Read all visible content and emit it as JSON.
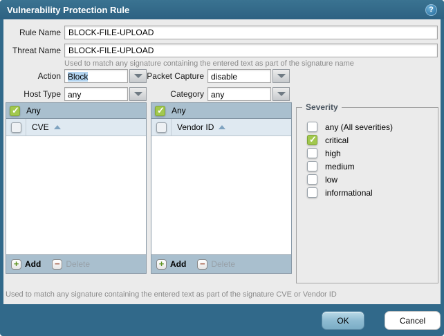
{
  "dialog": {
    "title": "Vulnerability Protection Rule"
  },
  "icons": {
    "help": "question-mark-circle",
    "dropdown": "chevron-down",
    "sort": "triangle-up-sort-asc",
    "add": "plus",
    "delete": "minus",
    "checked": "checkmark"
  },
  "fields": {
    "rule_name": {
      "label": "Rule Name",
      "value": "BLOCK-FILE-UPLOAD"
    },
    "threat_name": {
      "label": "Threat Name",
      "value": "BLOCK-FILE-UPLOAD",
      "helper": "Used to match any signature containing the entered text as part of the signature name"
    }
  },
  "dropdowns": {
    "action": {
      "label": "Action",
      "value": "Block"
    },
    "packet_capture": {
      "label": "Packet Capture",
      "value": "disable"
    },
    "host_type": {
      "label": "Host Type",
      "value": "any"
    },
    "category": {
      "label": "Category",
      "value": "any"
    }
  },
  "cve_panel": {
    "any_label": "Any",
    "any_checked": true,
    "column": "CVE",
    "add_label": "Add",
    "delete_label": "Delete"
  },
  "vendor_panel": {
    "any_label": "Any",
    "any_checked": true,
    "column": "Vendor ID",
    "add_label": "Add",
    "delete_label": "Delete"
  },
  "severity": {
    "legend": "Severity",
    "items": [
      {
        "label": "any (All severities)",
        "checked": false
      },
      {
        "label": "critical",
        "checked": true
      },
      {
        "label": "high",
        "checked": false
      },
      {
        "label": "medium",
        "checked": false
      },
      {
        "label": "low",
        "checked": false
      },
      {
        "label": "informational",
        "checked": false
      }
    ]
  },
  "bottom_note": "Used to match any signature containing the entered text as part of the signature CVE or Vendor ID",
  "footer": {
    "ok_label": "OK",
    "cancel_label": "Cancel"
  },
  "colors": {
    "frame": "#31698a",
    "panel_header": "#a9bfce",
    "column_header": "#dfe9f1",
    "check_green": "#a2c84e",
    "selection_highlight": "#b3d4f0"
  }
}
